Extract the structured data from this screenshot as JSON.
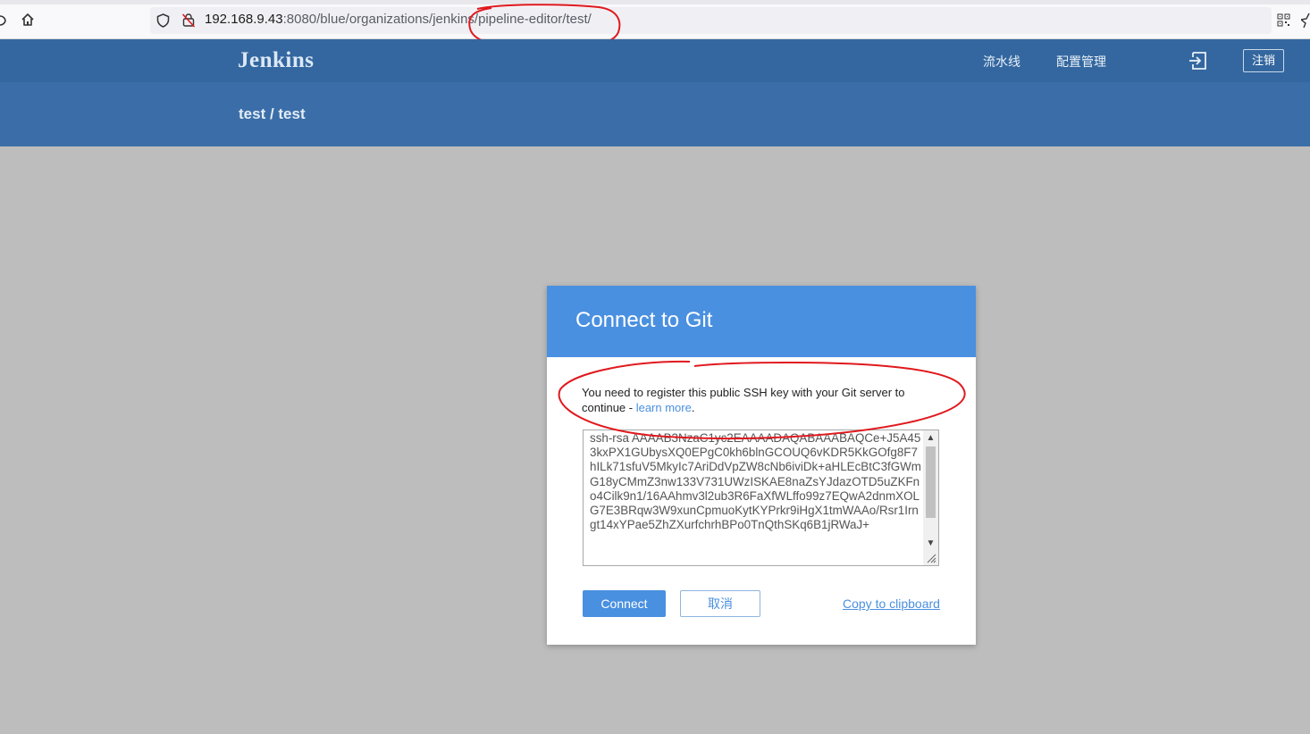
{
  "browser": {
    "url_host": "192.168.9.43",
    "url_rest": ":8080/blue/organizations/jenkins/pipeline-editor/test/"
  },
  "header": {
    "logo": "Jenkins",
    "nav": [
      "流水线",
      "配置管理"
    ],
    "logout_label": "注销"
  },
  "subheader": {
    "breadcrumb": "test / test"
  },
  "dialog": {
    "title": "Connect to Git",
    "message": "You need to register this public SSH key with your Git server to continue - ",
    "learn_more": "learn more",
    "message_end": ".",
    "ssh_key": "ssh-rsa AAAAB3NzaC1yc2EAAAADAQABAAABAQCe+J5A453kxPX1GUbysXQ0EPgC0kh6blnGCOUQ6vKDR5KkGOfg8F7hILk71sfuV5MkyIc7AriDdVpZW8cNb6iviDk+aHLEcBtC3fGWmG18yCMmZ3nw133V731UWzISKAE8naZsYJdazOTD5uZKFno4Cilk9n1/16AAhmv3l2ub3R6FaXfWLffo99z7EQwA2dnmXOLG7E3BRqw3W9xunCpmuoKytKYPrkr9iHgX1tmWAAo/Rsr1Irngt14xYPae5ZhZXurfchrhBPo0TnQthSKq6B1jRWaJ+",
    "connect_label": "Connect",
    "cancel_label": "取消",
    "copy_label": "Copy to clipboard"
  },
  "colors": {
    "header_bg": "#34679f",
    "subheader_bg": "#3b6ea8",
    "dialog_accent": "#4a90e0",
    "overlay_bg": "#bdbdbd",
    "annotation": "#e0191e"
  }
}
